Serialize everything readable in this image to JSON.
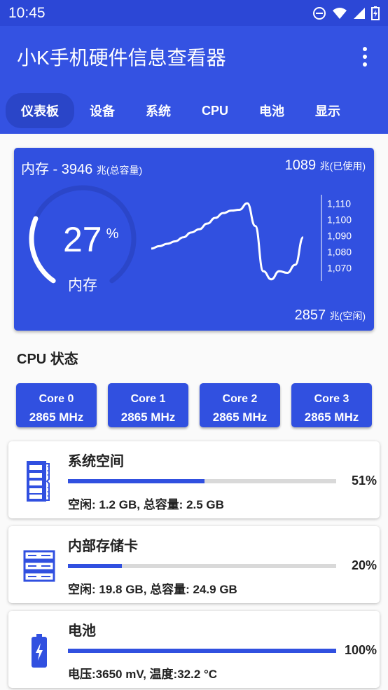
{
  "status_bar": {
    "time": "10:45"
  },
  "app_bar": {
    "title": "小K手机硬件信息查看器"
  },
  "tabs": [
    {
      "label": "仪表板",
      "selected": true
    },
    {
      "label": "设备"
    },
    {
      "label": "系统"
    },
    {
      "label": "CPU"
    },
    {
      "label": "电池"
    },
    {
      "label": "显示"
    }
  ],
  "memory": {
    "title": "内存 - 3946",
    "title_unit": "兆(总容量)",
    "used": "1089",
    "used_unit": "兆(已使用)",
    "free": "2857",
    "free_unit": "兆(空闲)",
    "percent": 27,
    "percent_text": "27",
    "percent_sign": "%",
    "gauge_label": "内存"
  },
  "chart_data": {
    "type": "line",
    "y_ticks": [
      "1,110",
      "1,100",
      "1,090",
      "1,080",
      "1,070"
    ],
    "ylim": [
      1062,
      1111
    ],
    "values": [
      1082,
      1083.5,
      1085,
      1086.5,
      1089,
      1092,
      1094,
      1097.5,
      1101,
      1104,
      1105.5,
      1106,
      1110,
      1096,
      1068,
      1063,
      1068,
      1067,
      1072,
      1089
    ]
  },
  "cpu": {
    "heading": "CPU 状态",
    "cores": [
      {
        "name": "Core 0",
        "freq": "2865 MHz"
      },
      {
        "name": "Core 1",
        "freq": "2865 MHz"
      },
      {
        "name": "Core 2",
        "freq": "2865 MHz"
      },
      {
        "name": "Core 3",
        "freq": "2865 MHz"
      }
    ]
  },
  "items": [
    {
      "title": "系统空间",
      "percent": 51,
      "percent_text": "51%",
      "detail": "空闲: 1.2 GB, 总容量: 2.5 GB",
      "icon": "memory-chip-icon"
    },
    {
      "title": "内部存储卡",
      "percent": 20,
      "percent_text": "20%",
      "detail": "空闲: 19.8 GB, 总容量: 24.9 GB",
      "icon": "storage-server-icon"
    },
    {
      "title": "电池",
      "percent": 100,
      "percent_text": "100%",
      "detail": "电压:3650 mV, 温度:32.2 °C",
      "icon": "battery-charging-icon"
    }
  ],
  "colors": {
    "primary": "#3150e0",
    "status_bar": "#2c47d6",
    "track": "#d9d9d9"
  }
}
